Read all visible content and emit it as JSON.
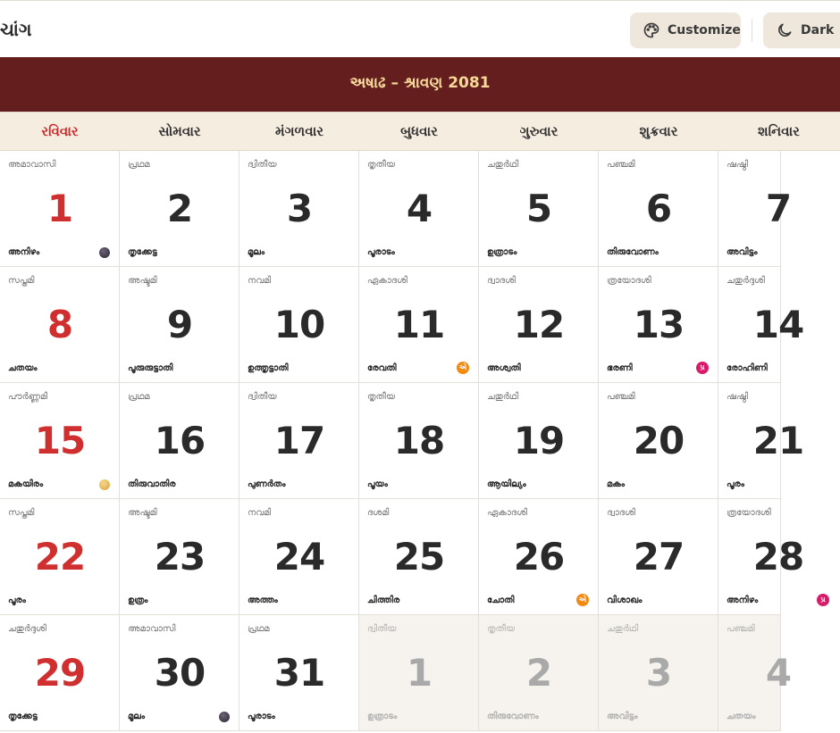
{
  "header": {
    "title": "ચાંગ",
    "customize_label": "Customize",
    "dark_label": "Dark"
  },
  "banner": {
    "month_label": "અષાઢ – શ્રાવણ 2081"
  },
  "weekdays": [
    "રવિવાર",
    "સોમવાર",
    "મંગળવાર",
    "બુધવાર",
    "ગુરુવાર",
    "શુક્રવાર",
    "શનિવાર"
  ],
  "days": [
    {
      "d": "1",
      "tithi": "അമാവാസി",
      "nak": "അനിഴം",
      "icon": "new-moon"
    },
    {
      "d": "2",
      "tithi": "പ്രഥമ",
      "nak": "തൃക്കേട്ട"
    },
    {
      "d": "3",
      "tithi": "ദ്വിതീയ",
      "nak": "മൂലം"
    },
    {
      "d": "4",
      "tithi": "തൃതീയ",
      "nak": "പൂരാടം"
    },
    {
      "d": "5",
      "tithi": "ചതുർഥി",
      "nak": "ഉത്രാടം"
    },
    {
      "d": "6",
      "tithi": "പഞ്ചമി",
      "nak": "തിരുവോണം"
    },
    {
      "d": "7",
      "tithi": "ഷഷ്ഠി",
      "nak": "അവിട്ടം"
    },
    {
      "d": "8",
      "tithi": "സപ്തമി",
      "nak": "ചതയം"
    },
    {
      "d": "9",
      "tithi": "അഷ്ടമി",
      "nak": "പൂരുരുട്ടാതി"
    },
    {
      "d": "10",
      "tithi": "നവമി",
      "nak": "ഉത്തൃട്ടാതി"
    },
    {
      "d": "11",
      "tithi": "ഏകാദശി",
      "nak": "രേവതി",
      "badge": "એ",
      "badge_color": "orange"
    },
    {
      "d": "12",
      "tithi": "ദ്വാദശി",
      "nak": "അശ്വതി"
    },
    {
      "d": "13",
      "tithi": "ത്രയോദശി",
      "nak": "ഭരണി",
      "badge": "પ્ર",
      "badge_color": "pink"
    },
    {
      "d": "14",
      "tithi": "ചതുർദ്ദശി",
      "nak": "രോഹിണി"
    },
    {
      "d": "15",
      "tithi": "പൗർണ്ണമി",
      "nak": "മകയിരം",
      "icon": "full-moon"
    },
    {
      "d": "16",
      "tithi": "പ്രഥമ",
      "nak": "തിരുവാതിര"
    },
    {
      "d": "17",
      "tithi": "ദ്വിതീയ",
      "nak": "പുണർതം"
    },
    {
      "d": "18",
      "tithi": "തൃതീയ",
      "nak": "പൂയം"
    },
    {
      "d": "19",
      "tithi": "ചതുർഥി",
      "nak": "ആയില്യം"
    },
    {
      "d": "20",
      "tithi": "പഞ്ചമി",
      "nak": "മകം"
    },
    {
      "d": "21",
      "tithi": "ഷഷ്ഠി",
      "nak": "പൂരം"
    },
    {
      "d": "22",
      "tithi": "സപ്തമി",
      "nak": "പൂരം"
    },
    {
      "d": "23",
      "tithi": "അഷ്ടമി",
      "nak": "ഉത്രം"
    },
    {
      "d": "24",
      "tithi": "നവമി",
      "nak": "അത്തം"
    },
    {
      "d": "25",
      "tithi": "ദശമി",
      "nak": "ചിത്തിര"
    },
    {
      "d": "26",
      "tithi": "ഏകാദശി",
      "nak": "ചോതി",
      "badge": "એ",
      "badge_color": "orange"
    },
    {
      "d": "27",
      "tithi": "ദ്വാദശി",
      "nak": "വിശാഖം"
    },
    {
      "d": "28",
      "tithi": "ത്രയോദശി",
      "nak": "അനിഴം",
      "badge": "પ્ર",
      "badge_color": "pink"
    },
    {
      "d": "29",
      "tithi": "ചതുർദ്ദശി",
      "nak": "തൃക്കേട്ട"
    },
    {
      "d": "30",
      "tithi": "അമാവാസി",
      "nak": "മൂലം",
      "icon": "new-moon"
    },
    {
      "d": "31",
      "tithi": "പ്രഥമ",
      "nak": "പൂരാടം"
    },
    {
      "d": "1",
      "tithi": "ദ്വിതീയ",
      "nak": "ഉത്രാടം",
      "other": true
    },
    {
      "d": "2",
      "tithi": "തൃതീയ",
      "nak": "തിരുവോണം",
      "other": true
    },
    {
      "d": "3",
      "tithi": "ചതുർഥി",
      "nak": "അവിട്ടം",
      "other": true
    },
    {
      "d": "4",
      "tithi": "പഞ്ചമി",
      "nak": "ചതയം",
      "other": true
    }
  ],
  "colors": {
    "banner": "#651e1e",
    "banner_text": "#f5d99a",
    "sunday": "#d02f2f",
    "weekday_bg": "#f6ede1",
    "button_bg": "#efe7db"
  }
}
